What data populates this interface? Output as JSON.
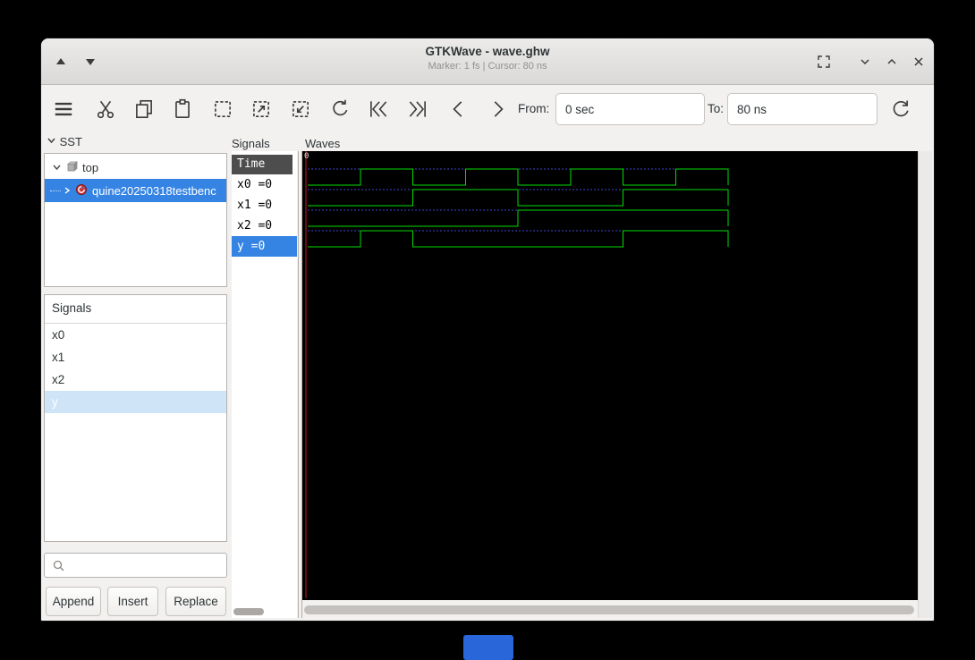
{
  "window": {
    "title": "GTKWave - wave.ghw",
    "status": "Marker: 1 fs  |  Cursor: 80 ns"
  },
  "toolbar": {
    "from_label": "From:",
    "from_value": "0 sec",
    "to_label": "To:",
    "to_value": "80 ns"
  },
  "sst": {
    "header": "SST",
    "tree": [
      {
        "label": "top"
      },
      {
        "label": "quine20250318testbenc"
      }
    ],
    "signals_header": "Signals",
    "signals": [
      "x0",
      "x1",
      "x2",
      "y"
    ],
    "selected_signal": "y",
    "search_value": "",
    "buttons": [
      "Append",
      "Insert",
      "Replace"
    ]
  },
  "signals_panel": {
    "header": "Signals",
    "time_header": "Time",
    "rows": [
      "x0 =0",
      "x1 =0",
      "x2 =0",
      "y =0"
    ],
    "selected_index": 3
  },
  "waves": {
    "header": "Waves",
    "ruler_label": "0"
  },
  "icons": {
    "titlebar": [
      "scroll-up",
      "scroll-down",
      "fullscreen",
      "chevron-down",
      "chevron-up",
      "close"
    ],
    "toolbar": [
      "menu",
      "cut",
      "copy",
      "paste",
      "selection-box",
      "zoom-in",
      "zoom-out",
      "undo",
      "seek-first",
      "seek-last",
      "step-back",
      "step-forward",
      "reload"
    ],
    "panel": [
      "expander-down",
      "expander-right",
      "module",
      "entity",
      "search"
    ]
  },
  "colors": {
    "accent": "#3584e4",
    "list_selection": "#cfe5f7",
    "time_header_bg": "#4d4d4d"
  },
  "chart_data": {
    "type": "digital-waveform",
    "title": "Waves",
    "time_unit": "ns",
    "t_start": 0,
    "t_end": 80,
    "ruler_labels": [
      "0"
    ],
    "marker_time_ns": 0,
    "signals": [
      {
        "name": "x0",
        "transitions": [
          [
            0,
            0
          ],
          [
            10,
            1
          ],
          [
            20,
            0
          ],
          [
            30,
            1
          ],
          [
            40,
            0
          ],
          [
            50,
            1
          ],
          [
            60,
            0
          ],
          [
            70,
            1
          ]
        ]
      },
      {
        "name": "x1",
        "transitions": [
          [
            0,
            0
          ],
          [
            20,
            1
          ],
          [
            40,
            0
          ],
          [
            60,
            1
          ]
        ]
      },
      {
        "name": "x2",
        "transitions": [
          [
            0,
            0
          ],
          [
            40,
            1
          ]
        ]
      },
      {
        "name": "y",
        "transitions": [
          [
            0,
            0
          ],
          [
            10,
            1
          ],
          [
            20,
            0
          ],
          [
            60,
            1
          ]
        ]
      }
    ],
    "colors": {
      "trace": "#00dd00",
      "grid": "#4545d0",
      "marker": "#d01818",
      "background": "#000000"
    }
  }
}
